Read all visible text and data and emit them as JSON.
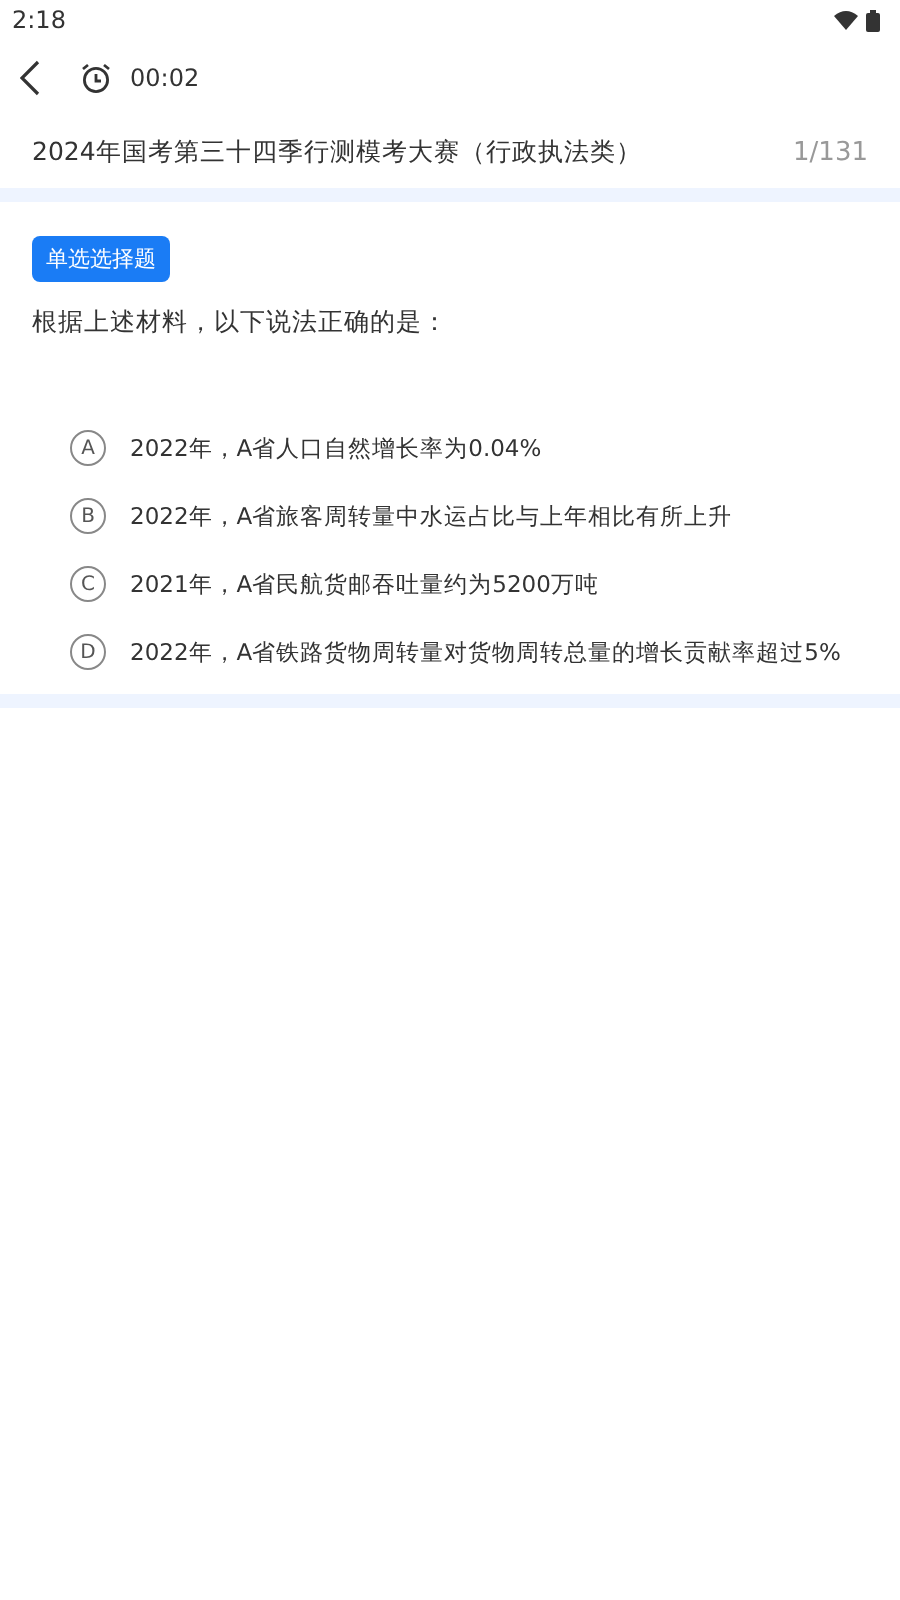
{
  "status_bar": {
    "time": "2:18"
  },
  "toolbar": {
    "timer": "00:02"
  },
  "exam": {
    "title": "2024年国考第三十四季行测模考大赛（行政执法类）",
    "progress": "1/131"
  },
  "question": {
    "type_tag": "单选选择题",
    "stem": "根据上述材料，以下说法正确的是：",
    "options": [
      {
        "letter": "A",
        "text": "2022年，A省人口自然增长率为0.04%",
        "selected": false
      },
      {
        "letter": "B",
        "text": "2022年，A省旅客周转量中水运占比与上年相比有所上升",
        "selected": false
      },
      {
        "letter": "C",
        "text": "2021年，A省民航货邮吞吐量约为5200万吨",
        "selected": false
      },
      {
        "letter": "D",
        "text": "2022年，A省铁路货物周转量对货物周转总量的增长贡献率超过5%",
        "selected": false
      }
    ]
  }
}
